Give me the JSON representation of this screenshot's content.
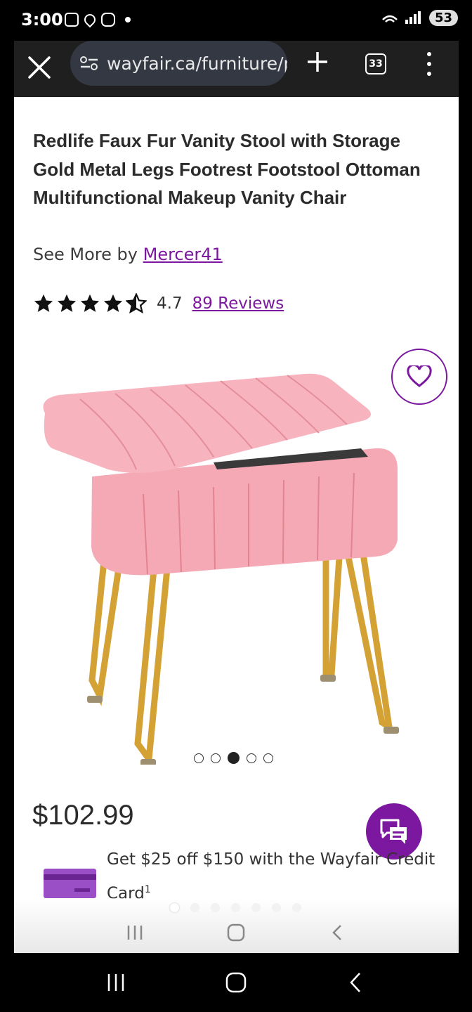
{
  "status_bar": {
    "time": "3:00",
    "battery": "53"
  },
  "browser": {
    "url": "wayfair.ca/furniture/pdp",
    "tab_count": "33"
  },
  "product": {
    "title": "Redlife Faux Fur Vanity Stool with Storage Gold Metal Legs Footrest Footstool Ottoman Multifunctional Makeup Vanity Chair",
    "see_more_prefix": "See More by",
    "brand": "Mercer41",
    "rating": "4.7",
    "rating_value": 4.7,
    "reviews": "89 Reviews",
    "image_count": 5,
    "active_image": 3,
    "price": "$102.99",
    "promo_line": "Get $25 off $150 with the Wayfair Credit",
    "promo_line2": "Card",
    "promo_sup": "1"
  },
  "icons": {
    "close": "close-icon",
    "tune": "tune-icon",
    "add": "plus-icon",
    "menu": "more-vertical-icon",
    "favorite": "heart-icon",
    "chat": "chat-icon",
    "card": "credit-card-icon",
    "recents": "recents-icon",
    "home": "home-icon",
    "back": "back-icon"
  },
  "colors": {
    "brand_purple": "#7b189f",
    "stool_pink": "#f4a9b5",
    "legs_gold": "#d4a234"
  }
}
